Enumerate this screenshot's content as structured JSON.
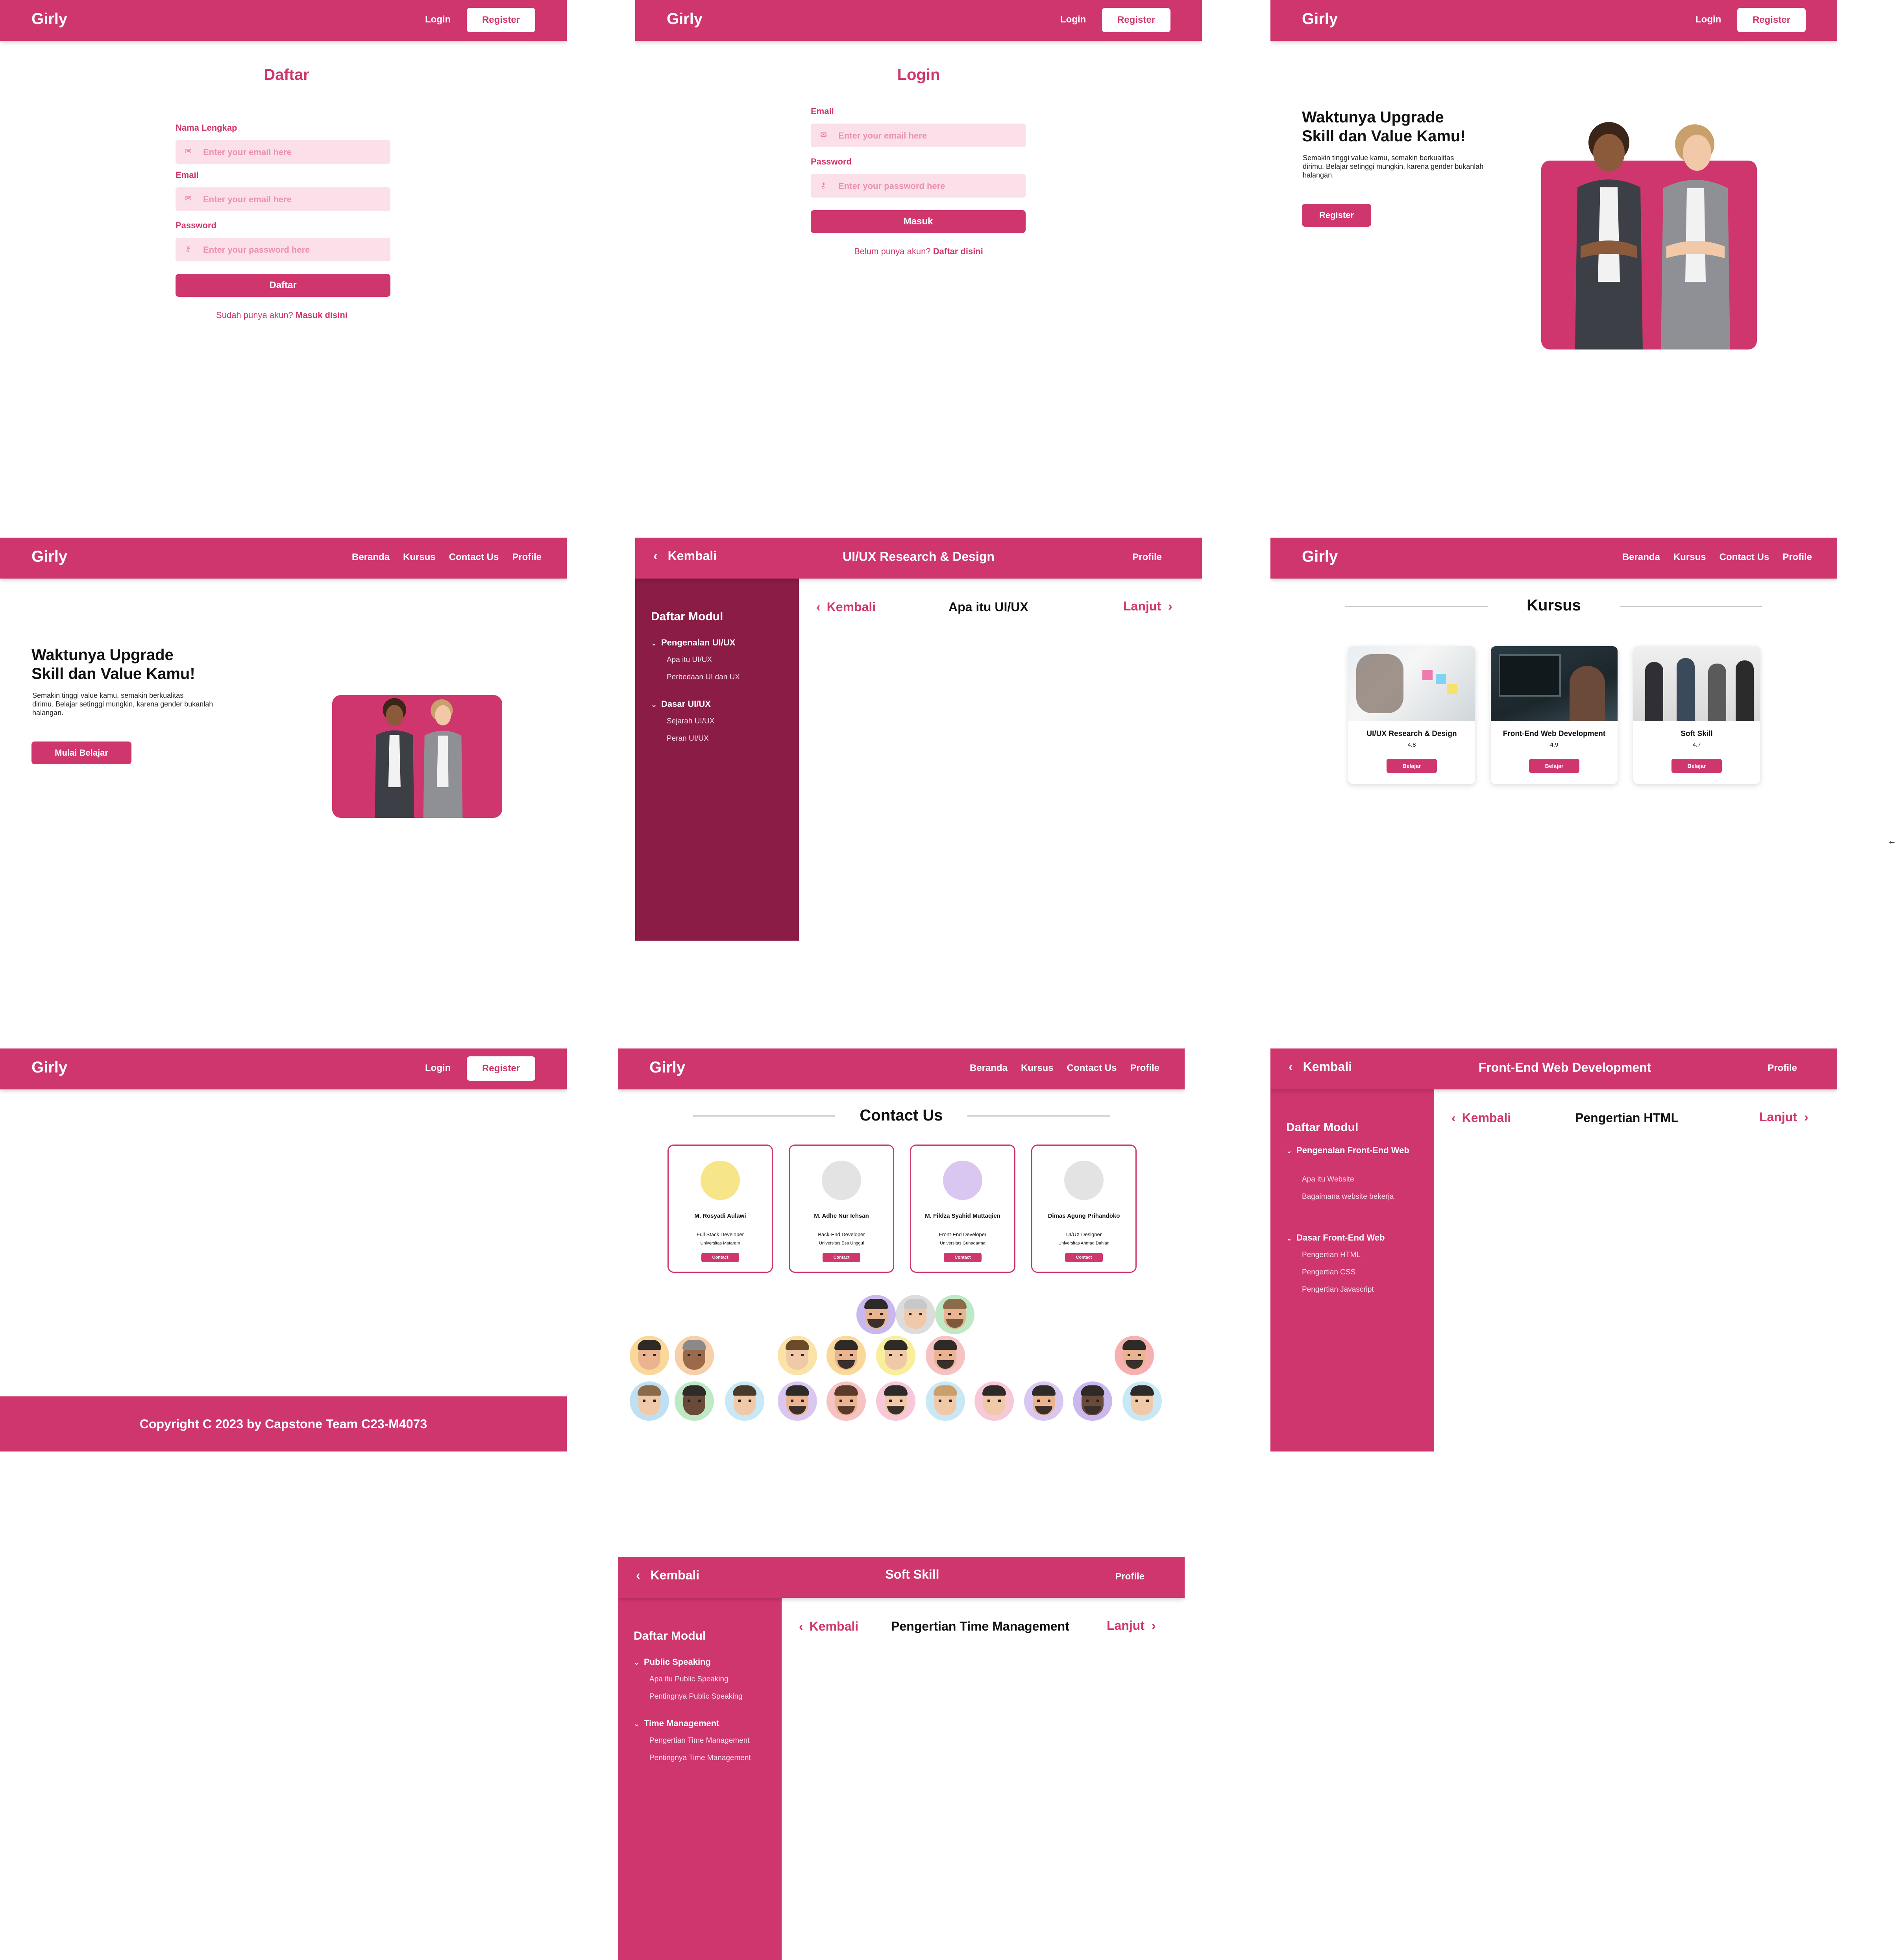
{
  "brand": "Girly",
  "colors": {
    "primary": "#d0366e",
    "primary_dark": "#8a1c45",
    "input_bg": "#fbe0ea"
  },
  "auth_nav": {
    "login": "Login",
    "register": "Register"
  },
  "main_nav": {
    "beranda": "Beranda",
    "kursus": "Kursus",
    "contact": "Contact Us",
    "profile": "Profile"
  },
  "register": {
    "title": "Daftar",
    "name_label": "Nama Lengkap",
    "name_placeholder": "Enter your email here",
    "email_label": "Email",
    "email_placeholder": "Enter your email here",
    "password_label": "Password",
    "password_placeholder": "Enter your password here",
    "submit": "Daftar",
    "footer_text": "Sudah punya akun?",
    "footer_link": "Masuk disini"
  },
  "login": {
    "title": "Login",
    "email_label": "Email",
    "email_placeholder": "Enter your email here",
    "password_label": "Password",
    "password_placeholder": "Enter your password here",
    "submit": "Masuk",
    "footer_text": "Belum punya akun?",
    "footer_link": "Daftar disini"
  },
  "landing": {
    "title_line1": "Waktunya Upgrade",
    "title_line2": "Skill dan Value Kamu!",
    "desc_line1": "Semakin tinggi value kamu, semakin berkualitas",
    "desc_line2": "dirimu. Belajar setinggi mungkin, karena gender bukanlah",
    "desc_line3": "halangan.",
    "cta_register": "Register",
    "cta_mulai": "Mulai Belajar"
  },
  "module_uiux": {
    "back": "Kembali",
    "title": "UI/UX Research & Design",
    "profile": "Profile",
    "sidebar_title": "Daftar Modul",
    "sections": [
      {
        "label": "Pengenalan UI/UX",
        "items": [
          "Apa itu UI/UX",
          "Perbedaan UI dan UX"
        ]
      },
      {
        "label": "Dasar UI/UX",
        "items": [
          "Sejarah UI/UX",
          "Peran UI/UX"
        ]
      }
    ],
    "content_back": "Kembali",
    "content_title": "Apa itu UI/UX",
    "content_next": "Lanjut"
  },
  "courses": {
    "title": "Kursus",
    "items": [
      {
        "name": "UI/UX Research & Design",
        "rating": "4.8",
        "button": "Belajar"
      },
      {
        "name": "Front-End Web Development",
        "rating": "4.9",
        "button": "Belajar"
      },
      {
        "name": "Soft Skill",
        "rating": "4.7",
        "button": "Belajar"
      }
    ]
  },
  "arrow_glyph": "←",
  "footer": {
    "copyright": "Copyright C 2023 by Capstone Team C23-M4073"
  },
  "contact": {
    "title": "Contact Us",
    "members": [
      {
        "name": "M. Rosyadi Aulawi",
        "role": "Full Stack Developer",
        "university": "Universitas Mataram",
        "button": "Contact",
        "avatar_bg": "#f7e58a"
      },
      {
        "name": "M. Adhe Nur Ichsan",
        "role": "Back-End Developer",
        "university": "Universitas Esa Unggul",
        "button": "Contact",
        "avatar_bg": "#e3e3e3"
      },
      {
        "name": "M. Fildza Syahid  Muttaqien",
        "role": "Front-End Developer",
        "university": "Universitas Gunadarma",
        "button": "Contact",
        "avatar_bg": "#d9c7f2"
      },
      {
        "name": "Dimas Agung Prihandoko",
        "role": "UI/UX Designer",
        "university": "Universitas Ahmad Dahlan",
        "button": "Contact",
        "avatar_bg": "#e3e3e3"
      }
    ]
  },
  "module_fe": {
    "back": "Kembali",
    "title": "Front-End Web Development",
    "profile": "Profile",
    "sidebar_title": "Daftar Modul",
    "sections": [
      {
        "label": "Pengenalan Front-End Web",
        "items": [
          "Apa itu Website",
          "Bagaimana website bekerja"
        ]
      },
      {
        "label": "Dasar Front-End Web",
        "items": [
          "Pengertian HTML",
          "Pengertian CSS",
          "Pengertian Javascript"
        ]
      }
    ],
    "content_back": "Kembali",
    "content_title": "Pengertian HTML",
    "content_next": "Lanjut"
  },
  "module_ss": {
    "back": "Kembali",
    "title": "Soft Skill",
    "profile": "Profile",
    "sidebar_title": "Daftar Modul",
    "sections": [
      {
        "label": "Public Speaking",
        "items": [
          "Apa itu Public Speaking",
          "Pentingnya Public Speaking"
        ]
      },
      {
        "label": "Time Management",
        "items": [
          "Pengertian Time Management",
          "Pentingnya Time Management"
        ]
      }
    ],
    "content_back": "Kembali",
    "content_title": "Pengertian Time Management",
    "content_next": "Lanjut"
  }
}
